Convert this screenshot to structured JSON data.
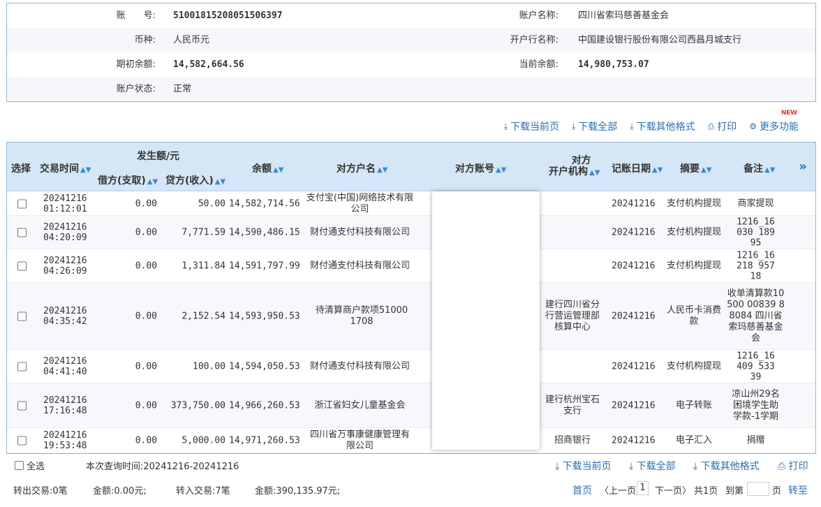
{
  "account": {
    "acct_no_label": "账　　号:",
    "acct_no": "51001815208051506397",
    "acct_name_label": "账户名称:",
    "acct_name": "四川省索玛慈善基金会",
    "currency_label": "币种:",
    "currency": "人民币元",
    "bank_label": "开户行名称:",
    "bank": "中国建设银行股份有限公司西昌月城支行",
    "opening_label": "期初余额:",
    "opening": "14,582,664.56",
    "current_label": "当前余额:",
    "current": "14,980,753.07",
    "status_label": "账户状态:",
    "status": "正常"
  },
  "toolbar": {
    "download_page": "下载当前页",
    "download_all": "下载全部",
    "download_other": "下载其他格式",
    "print": "打印",
    "more": "更多功能",
    "new_badge": "NEW"
  },
  "table": {
    "headers": {
      "select": "选择",
      "time": "交易时间",
      "amount_group": "发生额/元",
      "debit": "借方(支取)",
      "credit": "贷方(收入)",
      "balance": "余额",
      "party_name": "对方户名",
      "party_acct": "对方账号",
      "party_org_1": "对方",
      "party_org_2": "开户机构",
      "post_date": "记账日期",
      "summary": "摘要",
      "remark": "备注",
      "expand": "»"
    },
    "rows": [
      {
        "date": "20241216",
        "time": "01:12:01",
        "debit": "0.00",
        "credit": "50.00",
        "balance": "14,582,714.56",
        "party": "支付宝(中国)网络技术有限公司",
        "org": "",
        "post": "20241216",
        "summary": "支付机构提现",
        "remark": "商家提现"
      },
      {
        "date": "20241216",
        "time": "04:20:09",
        "debit": "0.00",
        "credit": "7,771.59",
        "balance": "14,590,486.15",
        "party": "财付通支付科技有限公司",
        "org": "",
        "post": "20241216",
        "summary": "支付机构提现",
        "remark": "1216_16030 18995"
      },
      {
        "date": "20241216",
        "time": "04:26:09",
        "debit": "0.00",
        "credit": "1,311.84",
        "balance": "14,591,797.99",
        "party": "财付通支付科技有限公司",
        "org": "",
        "post": "20241216",
        "summary": "支付机构提现",
        "remark": "1216_16218 95718"
      },
      {
        "date": "20241216",
        "time": "04:35:42",
        "debit": "0.00",
        "credit": "2,152.54",
        "balance": "14,593,950.53",
        "party": "待清算商户款项510001708",
        "org": "建行四川省分行营运管理部核算中心",
        "post": "20241216",
        "summary": "人民币卡消费款",
        "remark": "收单清算款10500 00839 88084 四川省索玛慈善基金会"
      },
      {
        "date": "20241216",
        "time": "04:41:40",
        "debit": "0.00",
        "credit": "100.00",
        "balance": "14,594,050.53",
        "party": "财付通支付科技有限公司",
        "org": "",
        "post": "20241216",
        "summary": "支付机构提现",
        "remark": "1216_16409 53339"
      },
      {
        "date": "20241216",
        "time": "17:16:48",
        "debit": "0.00",
        "credit": "373,750.00",
        "balance": "14,966,260.53",
        "party": "浙江省妇女儿童基金会",
        "org": "建行杭州宝石支行",
        "post": "20241216",
        "summary": "电子转账",
        "remark": "凉山州29名困境学生助学款-1学期"
      },
      {
        "date": "20241216",
        "time": "19:53:48",
        "debit": "0.00",
        "credit": "5,000.00",
        "balance": "14,971,260.53",
        "party": "四川省万事康健康管理有限公司",
        "org": "招商银行",
        "post": "20241216",
        "summary": "电子汇入",
        "remark": "捐赠"
      }
    ]
  },
  "footer": {
    "select_all": "全选",
    "query_time": "本次查询时间:20241216-20241216",
    "download_page": "下载当前页",
    "download_all": "下载全部",
    "download_other": "下载其他格式",
    "print": "打印",
    "out_txn": "转出交易:0笔",
    "out_amt": "金额:0.00元;",
    "in_txn": "转入交易:7笔",
    "in_amt": "金额:390,135.97元;",
    "first": "首页",
    "prev": "〈上一页",
    "page": "1",
    "next": "下一页〉",
    "total": "共1页",
    "goto": "到第",
    "page_unit": "页",
    "jump": "转至"
  }
}
